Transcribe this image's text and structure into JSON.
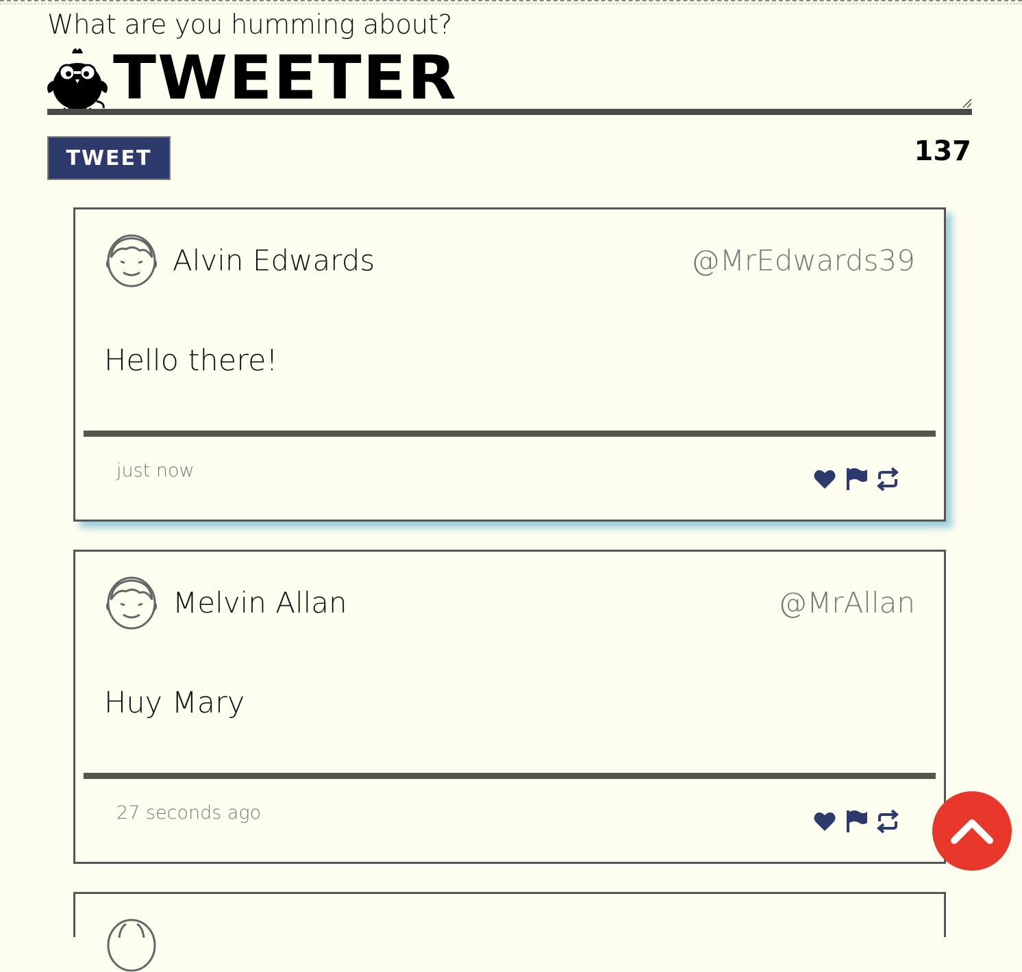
{
  "compose": {
    "prompt": "What are you humming about?",
    "brand_text": "TWEETER",
    "button_label": "TWEET",
    "char_count": "137"
  },
  "colors": {
    "background": "#fefef0",
    "button": "#2d3a6b",
    "icon_accent": "#2d3a6b",
    "scroll_top": "#e8372b",
    "card_shadow": "#78bed2"
  },
  "tweets": [
    {
      "name": "Alvin Edwards",
      "handle": "@MrEdwards39",
      "text": "Hello there!",
      "timestamp": "just now"
    },
    {
      "name": "Melvin Allan",
      "handle": "@MrAllan",
      "text": "Huy Mary",
      "timestamp": "27 seconds ago"
    }
  ],
  "icons": {
    "like": "heart-icon",
    "flag": "flag-icon",
    "retweet": "retweet-icon",
    "scroll_top": "chevron-up-icon"
  }
}
